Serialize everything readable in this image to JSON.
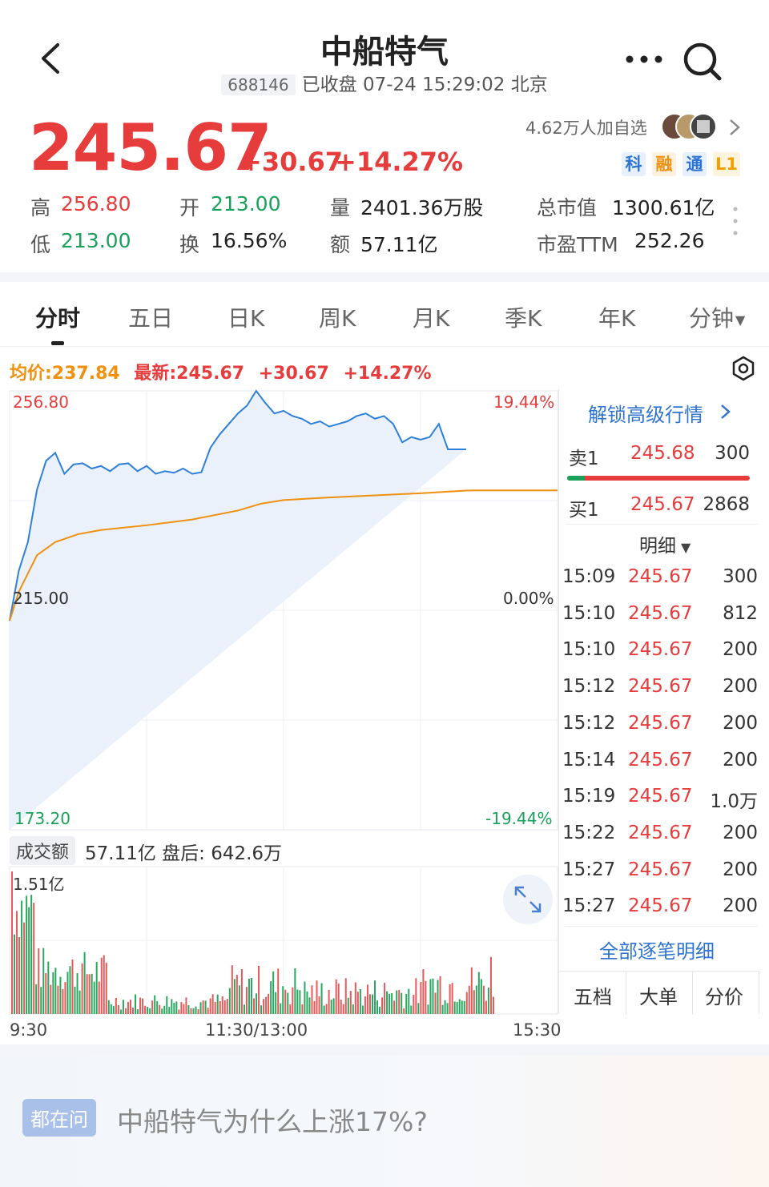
{
  "header": {
    "title": "中船特气",
    "code": "688146",
    "status": "已收盘 07-24 15:29:02 北京"
  },
  "quote": {
    "price": "245.67",
    "change": "+30.67",
    "change_pct": "+14.27%",
    "watchers": "4.62万人加自选",
    "tags": [
      {
        "label": "科",
        "color": "#2f74d0",
        "bg": "#e8f0fb"
      },
      {
        "label": "融",
        "color": "#f0900f",
        "bg": "#fdf1e2"
      },
      {
        "label": "通",
        "color": "#2f74d0",
        "bg": "#e8f0fb"
      },
      {
        "label": "L1",
        "color": "#f0a000",
        "bg": "#fdf4de"
      }
    ]
  },
  "stats": {
    "high_label": "高",
    "high": "256.80",
    "low_label": "低",
    "low": "213.00",
    "open_label": "开",
    "open": "213.00",
    "turnover_label": "换",
    "turnover": "16.56%",
    "volume_label": "量",
    "volume": "2401.36万股",
    "amount_label": "额",
    "amount": "57.11亿",
    "mcap_label": "总市值",
    "mcap": "1300.61亿",
    "pe_label": "市盈TTM",
    "pe": "252.26"
  },
  "tabs": [
    "分时",
    "五日",
    "日K",
    "周K",
    "月K",
    "季K",
    "年K",
    "分钟"
  ],
  "active_tab": 0,
  "info_row": {
    "avg": "均价:237.84",
    "latest": "最新:245.67",
    "change": "+30.67",
    "change_pct": "+14.27%"
  },
  "chart_labels": {
    "y_top": "256.80",
    "y_top_pct": "19.44%",
    "y_mid": "215.00",
    "y_mid_pct": "0.00%",
    "y_bottom": "173.20",
    "y_bottom_pct": "-19.44%",
    "vol_max": "1.51亿",
    "time_start": "9:30",
    "time_mid": "11:30/13:00",
    "time_end": "15:30"
  },
  "volume_header": {
    "chip": "成交额",
    "text": "57.11亿  盘后: 642.6万"
  },
  "chart_data": {
    "type": "line",
    "title": "",
    "x_axis_labels": [
      "9:30",
      "11:30/13:00",
      "15:30"
    ],
    "ylim": [
      173.2,
      256.8
    ],
    "prev_close": 215.0,
    "grid": true,
    "series": [
      {
        "name": "",
        "color": "#2f80d8",
        "x_index": [
          0,
          4,
          8,
          12,
          16,
          20,
          24,
          28,
          32,
          36,
          40,
          44,
          48,
          52,
          56,
          60,
          64,
          68,
          72,
          76,
          80,
          84,
          88,
          92,
          96,
          100,
          104,
          108,
          112,
          116,
          120,
          124,
          128,
          132,
          136,
          140,
          144,
          148,
          152,
          156,
          160,
          164,
          168,
          172,
          176,
          180,
          184,
          188,
          192,
          196,
          200,
          204,
          208,
          212,
          216,
          220,
          224,
          228,
          232,
          236,
          240
        ],
        "values": [
          213.0,
          222.5,
          228.0,
          238.0,
          243.5,
          245.0,
          241.0,
          242.8,
          243.0,
          242.0,
          242.5,
          241.5,
          242.8,
          243.0,
          241.5,
          242.5,
          241.0,
          241.5,
          241.2,
          242.0,
          241.0,
          241.3,
          246.0,
          248.5,
          250.5,
          252.5,
          254.0,
          256.8,
          254.5,
          252.5,
          253.0,
          252.0,
          251.5,
          250.5,
          251.0,
          250.0,
          250.5,
          251.0,
          252.0,
          252.5,
          251.5,
          252.0,
          250.5,
          247.0,
          248.0,
          247.5,
          248.0,
          250.5,
          245.67,
          245.67,
          245.67
        ]
      },
      {
        "name": "",
        "color": "#f0900f",
        "x_index": [
          0,
          4,
          8,
          12,
          20,
          30,
          40,
          60,
          80,
          100,
          110,
          120,
          140,
          160,
          180,
          200,
          204,
          240
        ],
        "values": [
          213.0,
          218.5,
          222.0,
          225.5,
          228.0,
          229.5,
          230.3,
          231.2,
          232.3,
          234.0,
          235.3,
          236.0,
          236.5,
          236.9,
          237.3,
          237.8,
          237.84,
          237.84
        ]
      }
    ]
  },
  "orderbook": {
    "unlock": "解锁高级行情",
    "ask_label": "卖1",
    "ask_price": "245.68",
    "ask_vol": "300",
    "bid_label": "买1",
    "bid_price": "245.67",
    "bid_vol": "2868"
  },
  "ticks_header": "明细",
  "ticks": [
    {
      "time": "15:09",
      "price": "245.67",
      "vol": "300"
    },
    {
      "time": "15:10",
      "price": "245.67",
      "vol": "812"
    },
    {
      "time": "15:10",
      "price": "245.67",
      "vol": "200"
    },
    {
      "time": "15:12",
      "price": "245.67",
      "vol": "200"
    },
    {
      "time": "15:12",
      "price": "245.67",
      "vol": "200"
    },
    {
      "time": "15:14",
      "price": "245.67",
      "vol": "200"
    },
    {
      "time": "15:19",
      "price": "245.67",
      "vol": "1.0万"
    },
    {
      "time": "15:22",
      "price": "245.67",
      "vol": "200"
    },
    {
      "time": "15:27",
      "price": "245.67",
      "vol": "200"
    },
    {
      "time": "15:27",
      "price": "245.67",
      "vol": "200"
    }
  ],
  "all_ticks": "全部逐笔明细",
  "bottom_tabs": [
    "五档",
    "大单",
    "分价"
  ],
  "banner": {
    "chip": "都在问",
    "question": "中船特气为什么上涨17%?"
  }
}
